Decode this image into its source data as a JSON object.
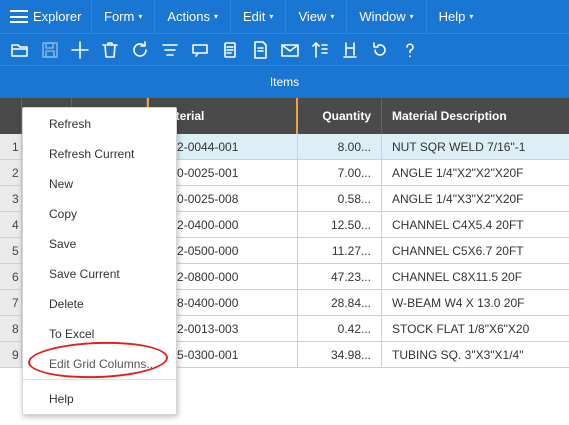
{
  "menubar": {
    "explorer_label": "Explorer",
    "menus": [
      {
        "label": "Form",
        "caret": "▾"
      },
      {
        "label": "Actions",
        "caret": "▾"
      },
      {
        "label": "Edit",
        "caret": "▾"
      },
      {
        "label": "View",
        "caret": "▾"
      },
      {
        "label": "Window",
        "caret": "▾"
      },
      {
        "label": "Help",
        "caret": "▾"
      }
    ]
  },
  "toolbar": {
    "icons": [
      "open-folder-icon",
      "save-icon",
      "add-icon",
      "delete-icon",
      "refresh-icon",
      "filter-icon",
      "comment-icon",
      "notes-icon",
      "document-icon",
      "email-icon",
      "sort-icon",
      "pin-icon",
      "undo-icon",
      "help-icon"
    ]
  },
  "section": {
    "title": "Items"
  },
  "grid": {
    "columns": [
      "",
      "",
      "",
      "Material",
      "Quantity",
      "Material Description"
    ],
    "rows": [
      {
        "num": "1",
        "material": "3812-0044-001",
        "quantity": "8.00...",
        "description": "NUT SQR WELD 7/16\"-1"
      },
      {
        "num": "2",
        "material": "6600-0025-001",
        "quantity": "7.00...",
        "description": "ANGLE 1/4\"X2\"X2\"X20F"
      },
      {
        "num": "3",
        "material": "6600-0025-008",
        "quantity": "0.58...",
        "description": "ANGLE 1/4\"X3\"X2\"X20F"
      },
      {
        "num": "4",
        "material": "6602-0400-000",
        "quantity": "12.50...",
        "description": "CHANNEL C4X5.4 20FT"
      },
      {
        "num": "5",
        "material": "6602-0500-000",
        "quantity": "11.27...",
        "description": "CHANNEL C5X6.7 20FT"
      },
      {
        "num": "6",
        "material": "6602-0800-000",
        "quantity": "47.23...",
        "description": "CHANNEL C8X11.5 20F"
      },
      {
        "num": "7",
        "material": "6608-0400-000",
        "quantity": "28.84...",
        "description": "W-BEAM W4 X 13.0 20F"
      },
      {
        "num": "8",
        "material": "6652-0013-003",
        "quantity": "0.42...",
        "description": "STOCK FLAT 1/8\"X6\"X20"
      },
      {
        "num": "9",
        "material": "7215-0300-001",
        "quantity": "34.98...",
        "description": "TUBING SQ. 3\"X3\"X1/4\""
      }
    ]
  },
  "context_menu": {
    "items": [
      "Refresh",
      "Refresh Current",
      "New",
      "Copy",
      "Save",
      "Save Current",
      "Delete",
      "To Excel",
      "Edit Grid Columns..."
    ],
    "help": "Help"
  },
  "colors": {
    "accent": "#1976d2",
    "annotation": "#e02020",
    "header_highlight": "#f0a33c"
  }
}
